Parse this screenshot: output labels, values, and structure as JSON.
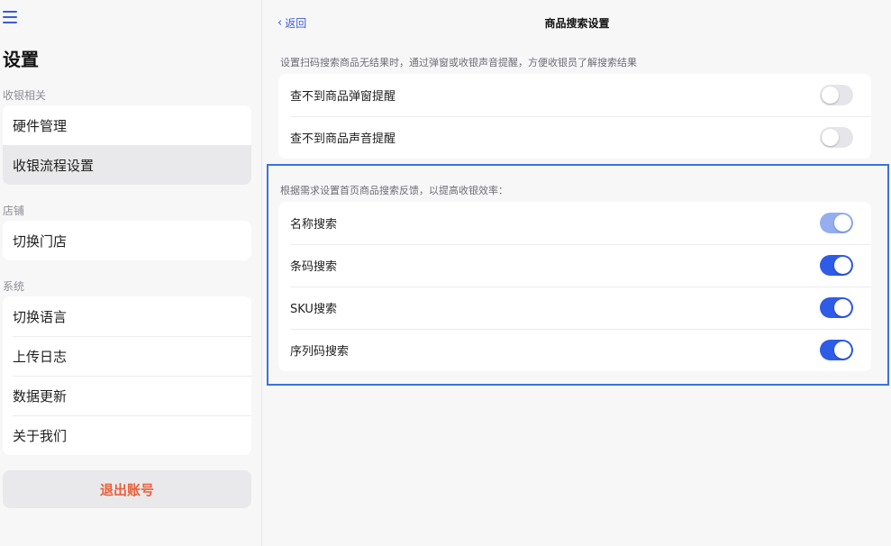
{
  "colors": {
    "accent": "#2e5ce6",
    "accent_disabled": "#94aef0",
    "logout": "#e8603c",
    "highlight": "#3a72dd"
  },
  "sidebar": {
    "menu_icon": "hamburger-icon",
    "title": "设置",
    "sections": [
      {
        "label": "收银相关",
        "items": [
          {
            "label": "硬件管理",
            "active": false
          },
          {
            "label": "收银流程设置",
            "active": true
          }
        ]
      },
      {
        "label": "店铺",
        "items": [
          {
            "label": "切换门店",
            "active": false
          }
        ]
      },
      {
        "label": "系统",
        "items": [
          {
            "label": "切换语言"
          },
          {
            "label": "上传日志"
          },
          {
            "label": "数据更新"
          },
          {
            "label": "关于我们"
          }
        ]
      }
    ],
    "logout_label": "退出账号"
  },
  "header": {
    "back_label": "返回",
    "back_icon": "chevron-left-icon",
    "title": "商品搜索设置"
  },
  "group1": {
    "hint": "设置扫码搜索商品无结果时，通过弹窗或收银声音提醒，方便收银员了解搜索结果",
    "rows": [
      {
        "label": "查不到商品弹窗提醒",
        "on": false
      },
      {
        "label": "查不到商品声音提醒",
        "on": false
      }
    ]
  },
  "group2": {
    "hint": "根据需求设置首页商品搜索反馈，以提高收银效率：",
    "rows": [
      {
        "label": "名称搜索",
        "on": true,
        "disabled": true
      },
      {
        "label": "条码搜索",
        "on": true
      },
      {
        "label": "SKU搜索",
        "on": true
      },
      {
        "label": "序列码搜索",
        "on": true
      }
    ]
  }
}
